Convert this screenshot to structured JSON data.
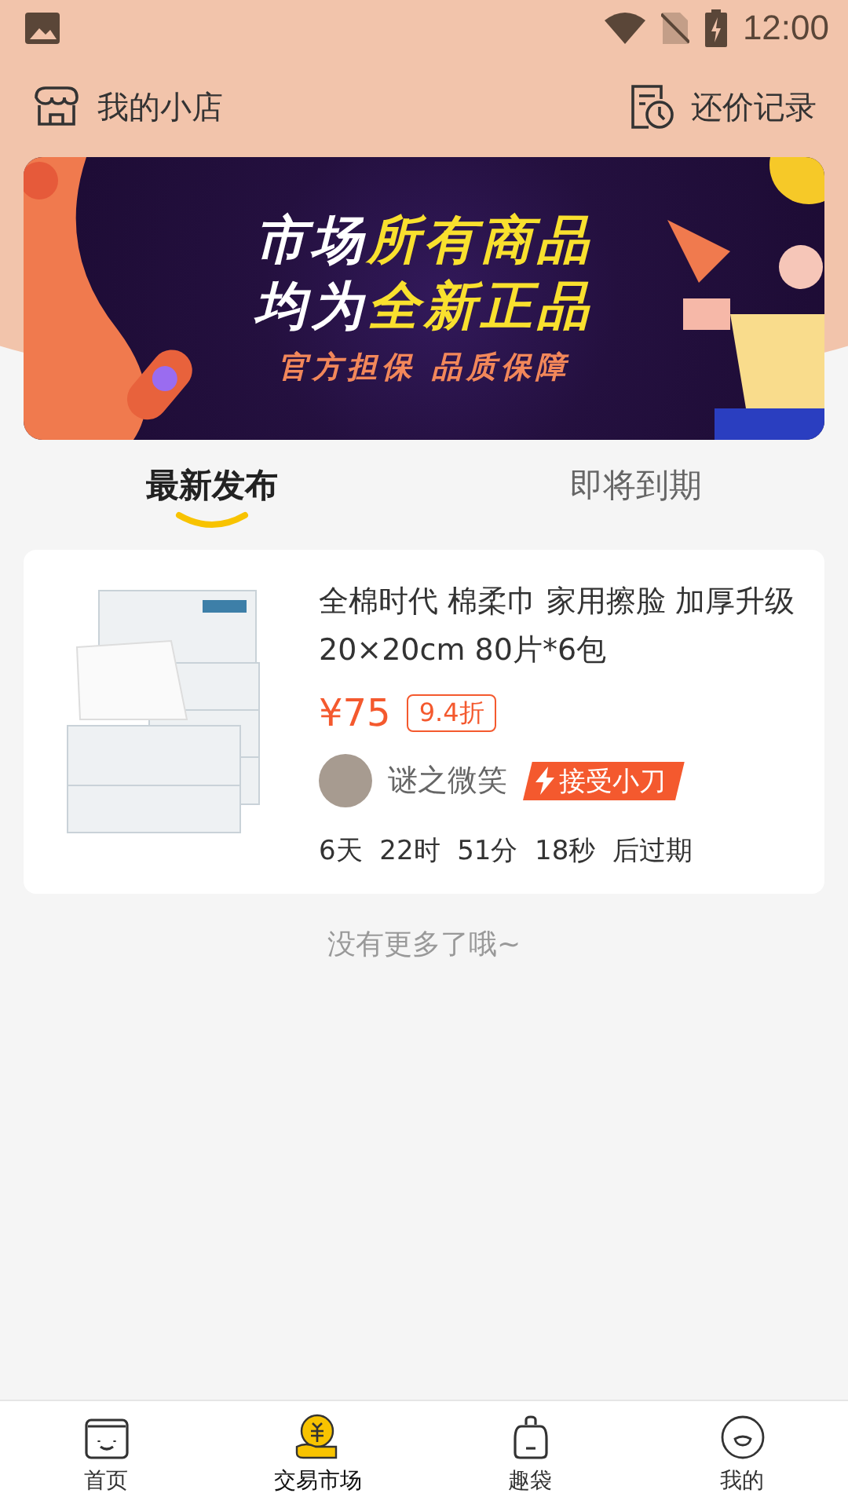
{
  "status_bar": {
    "time": "12:00"
  },
  "header": {
    "left": "我的小店",
    "right": "还价记录"
  },
  "banner": {
    "line_1_white": "市场",
    "line_1_yellow": "所有商品",
    "line_2_white": "均为",
    "line_2_yellow": "全新正品",
    "subtitle": "官方担保 品质保障"
  },
  "tabs": [
    {
      "label": "最新发布",
      "selected": true
    },
    {
      "label": "即将到期",
      "selected": false
    }
  ],
  "listings": [
    {
      "title": "全棉时代 棉柔巾 家用擦脸 加厚升级 20×20cm 80片*6包",
      "price": "¥75",
      "discount": "9.4折",
      "seller": "谜之微笑",
      "tag": "接受小刀",
      "countdown": "6天  22时  51分  18秒  后过期"
    }
  ],
  "end_note": "没有更多了哦~",
  "bottom_nav": [
    {
      "label": "首页",
      "kind": "home",
      "selected": false
    },
    {
      "label": "交易市场",
      "kind": "market",
      "selected": true
    },
    {
      "label": "趣袋",
      "kind": "bag",
      "selected": false
    },
    {
      "label": "我的",
      "kind": "me",
      "selected": false
    }
  ]
}
